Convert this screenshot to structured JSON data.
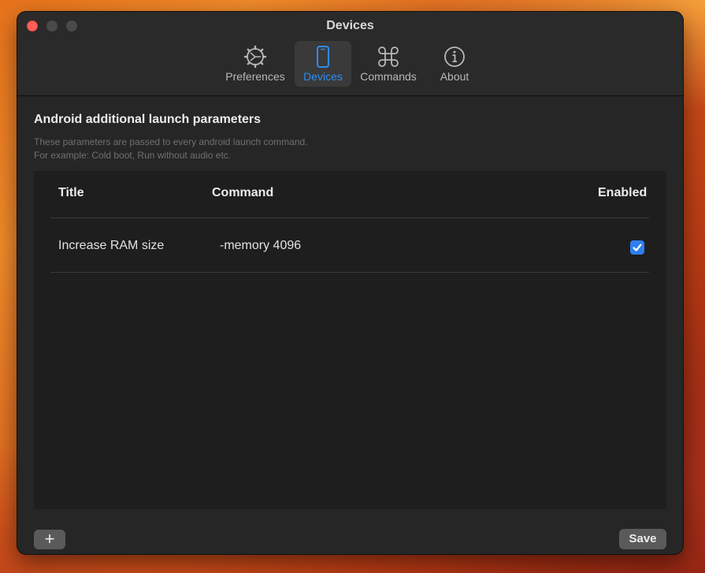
{
  "window": {
    "title": "Devices"
  },
  "toolbar": {
    "tabs": [
      {
        "label": "Preferences",
        "icon": "gear-icon",
        "active": false
      },
      {
        "label": "Devices",
        "icon": "phone-icon",
        "active": true
      },
      {
        "label": "Commands",
        "icon": "command-icon",
        "active": false
      },
      {
        "label": "About",
        "icon": "info-icon",
        "active": false
      }
    ]
  },
  "section": {
    "title": "Android additional launch parameters",
    "description_line1": "These parameters are passed to every android launch command.",
    "description_line2": "For example: Cold boot, Run without audio etc."
  },
  "table": {
    "headers": {
      "title": "Title",
      "command": "Command",
      "enabled": "Enabled"
    },
    "rows": [
      {
        "title": "Increase RAM size",
        "command": "-memory 4096",
        "enabled": true
      }
    ]
  },
  "footer": {
    "add_label": "+",
    "save_label": "Save"
  },
  "colors": {
    "accent": "#2f8cf0",
    "window_bg": "#262626",
    "close_button": "#ff5f57"
  }
}
